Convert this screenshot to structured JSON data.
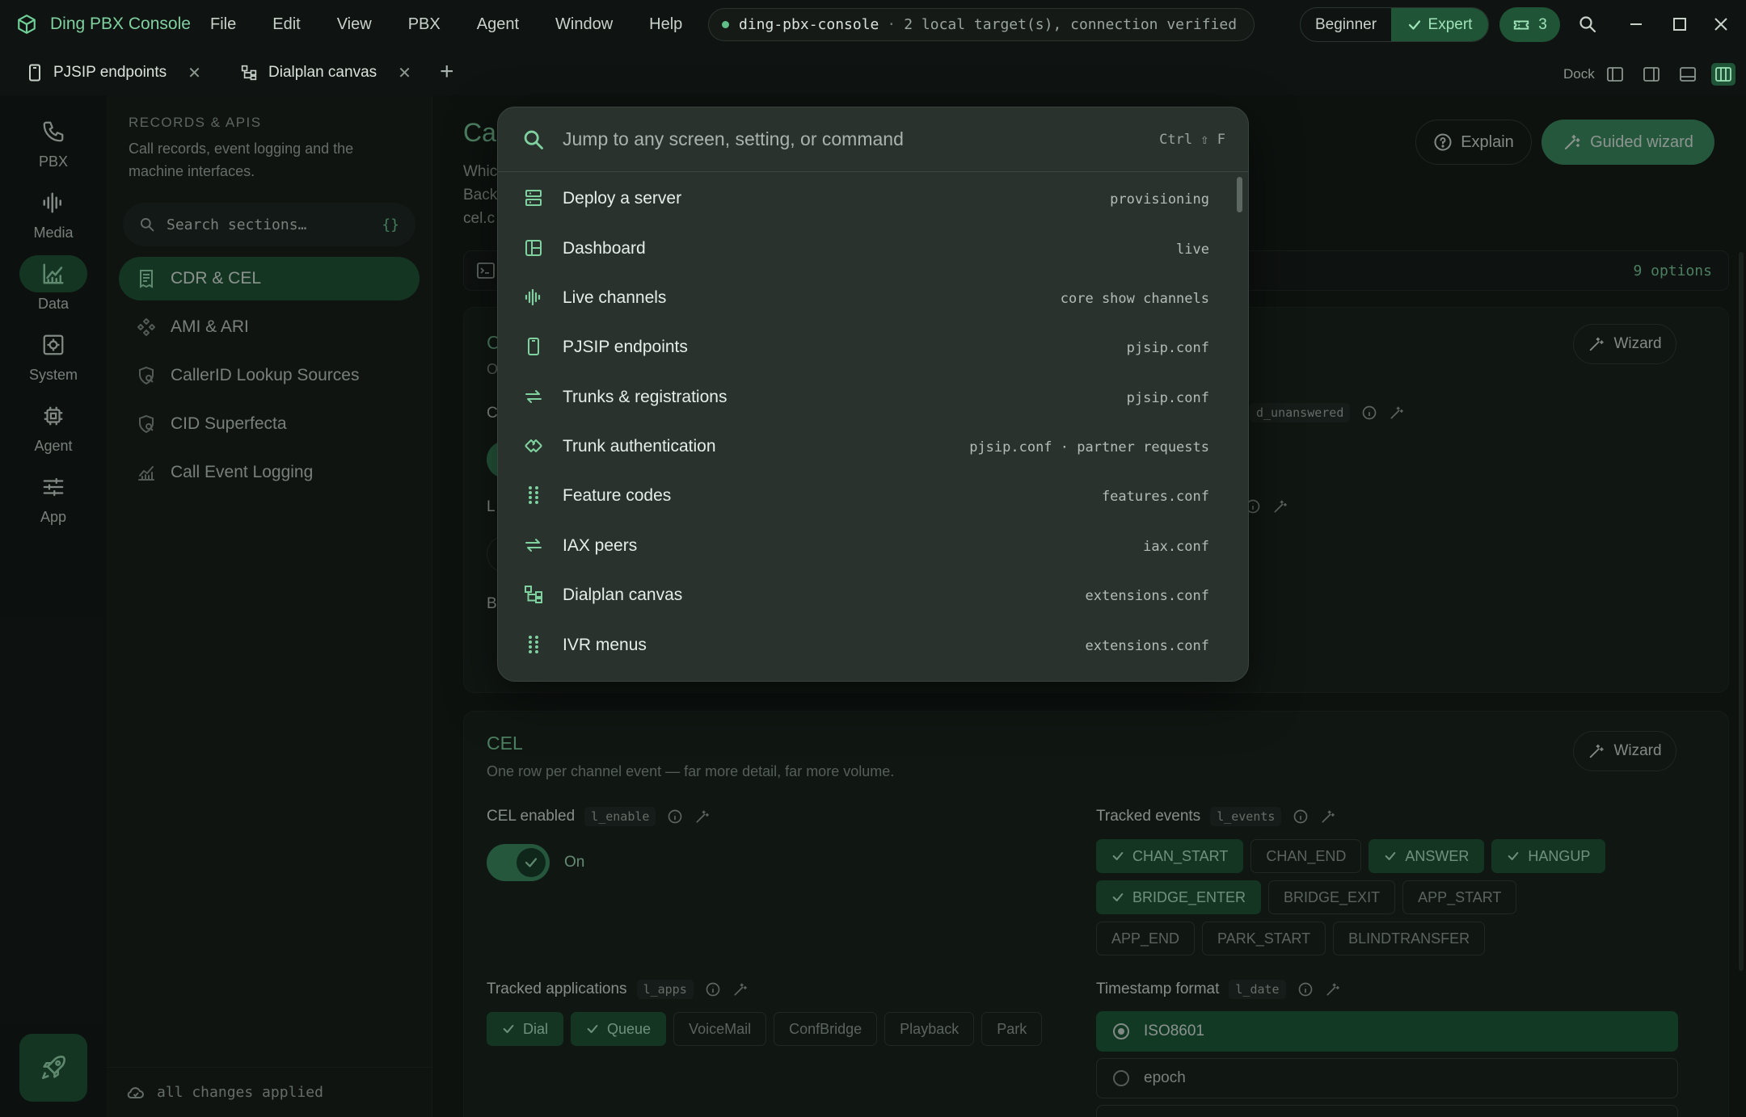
{
  "app": {
    "title": "Ding PBX Console",
    "menu": [
      "File",
      "Edit",
      "View",
      "PBX",
      "Agent",
      "Window",
      "Help"
    ],
    "connection": {
      "host": "ding-pbx-console",
      "separator": "·",
      "status": "2 local target(s), connection verified"
    },
    "modes": {
      "beginner": "Beginner",
      "expert": "Expert",
      "active": "Expert"
    },
    "ticket_count": "3"
  },
  "tabs": [
    {
      "label": "PJSIP endpoints",
      "icon": "phone-device-icon"
    },
    {
      "label": "Dialplan canvas",
      "icon": "flow-diagram-icon"
    }
  ],
  "dock": {
    "label": "Dock"
  },
  "rail": {
    "items": [
      {
        "label": "PBX",
        "icon": "phone-icon",
        "active": false
      },
      {
        "label": "Media",
        "icon": "waveform-icon",
        "active": false
      },
      {
        "label": "Data",
        "icon": "chart-icon",
        "active": true
      },
      {
        "label": "System",
        "icon": "gear-icon",
        "active": false
      },
      {
        "label": "Agent",
        "icon": "chip-icon",
        "active": false
      },
      {
        "label": "App",
        "icon": "sliders-icon",
        "active": false
      }
    ]
  },
  "sections": {
    "heading": "RECORDS & APIS",
    "description": "Call records, event logging and the machine interfaces.",
    "search_placeholder": "Search sections…",
    "search_braces": "{}",
    "items": [
      {
        "label": "CDR & CEL",
        "icon": "receipt-icon",
        "active": true
      },
      {
        "label": "AMI & ARI",
        "icon": "api-icon",
        "active": false
      },
      {
        "label": "CallerID Lookup Sources",
        "icon": "shield-lookup-icon",
        "active": false
      },
      {
        "label": "CID Superfecta",
        "icon": "shield-lookup-icon",
        "active": false
      },
      {
        "label": "Call Event Logging",
        "icon": "chart-icon",
        "active": false
      }
    ],
    "footer": "all changes applied"
  },
  "main": {
    "title_visible": "Ca",
    "desc_visible": "Whic\nBack\ncel.c",
    "explain_label": "Explain",
    "guided_wizard_label": "Guided wizard",
    "options_count": "9 options",
    "cdr_card": {
      "title_visible": "C",
      "sub_visible": "O",
      "wizard_label": "Wizard",
      "label1_visible": "C",
      "label1_key_visible": "d_unanswered",
      "label2_visible": "L",
      "label3_visible": "B"
    },
    "cel_card": {
      "title": "CEL",
      "subtitle": "One row per channel event — far more detail, far more volume.",
      "wizard_label": "Wizard",
      "enabled_label": "CEL enabled",
      "enabled_key": "l_enable",
      "enabled_state": "On",
      "tracked_events_label": "Tracked events",
      "tracked_events_key": "l_events",
      "events": [
        {
          "label": "CHAN_START",
          "on": true
        },
        {
          "label": "CHAN_END",
          "on": false
        },
        {
          "label": "ANSWER",
          "on": true
        },
        {
          "label": "HANGUP",
          "on": true
        },
        {
          "label": "BRIDGE_ENTER",
          "on": true
        },
        {
          "label": "BRIDGE_EXIT",
          "on": false
        },
        {
          "label": "APP_START",
          "on": false
        },
        {
          "label": "APP_END",
          "on": false
        },
        {
          "label": "PARK_START",
          "on": false
        },
        {
          "label": "BLINDTRANSFER",
          "on": false
        }
      ],
      "tracked_apps_label": "Tracked applications",
      "tracked_apps_key": "l_apps",
      "apps": [
        {
          "label": "Dial",
          "on": true
        },
        {
          "label": "Queue",
          "on": true
        },
        {
          "label": "VoiceMail",
          "on": false
        },
        {
          "label": "ConfBridge",
          "on": false
        },
        {
          "label": "Playback",
          "on": false
        },
        {
          "label": "Park",
          "on": false
        }
      ],
      "timestamp_label": "Timestamp format",
      "timestamp_key": "l_date",
      "timestamp_options": [
        {
          "label": "ISO8601",
          "selected": true
        },
        {
          "label": "epoch",
          "selected": false
        }
      ]
    }
  },
  "palette": {
    "placeholder": "Jump to any screen, setting, or command",
    "shortcut": "Ctrl ⇧ F",
    "items": [
      {
        "label": "Deploy a server",
        "source": "provisioning",
        "icon": "server-icon"
      },
      {
        "label": "Dashboard",
        "source": "live",
        "icon": "dashboard-icon"
      },
      {
        "label": "Live channels",
        "source": "core show channels",
        "icon": "waveform-icon"
      },
      {
        "label": "PJSIP endpoints",
        "source": "pjsip.conf",
        "icon": "phone-device-icon"
      },
      {
        "label": "Trunks & registrations",
        "source": "pjsip.conf",
        "icon": "arrows-exchange-icon"
      },
      {
        "label": "Trunk authentication",
        "source": "pjsip.conf · partner requests",
        "icon": "handshake-icon"
      },
      {
        "label": "Feature codes",
        "source": "features.conf",
        "icon": "keypad-icon"
      },
      {
        "label": "IAX peers",
        "source": "iax.conf",
        "icon": "arrows-exchange-icon"
      },
      {
        "label": "Dialplan canvas",
        "source": "extensions.conf",
        "icon": "flow-diagram-icon"
      },
      {
        "label": "IVR menus",
        "source": "extensions.conf",
        "icon": "keypad-icon"
      }
    ]
  },
  "colors": {
    "accent": "#7fd1a0",
    "accent_dark": "#1f5436",
    "button_green": "#3c8d61",
    "background": "#111513",
    "palette_bg": "#2a322d"
  }
}
